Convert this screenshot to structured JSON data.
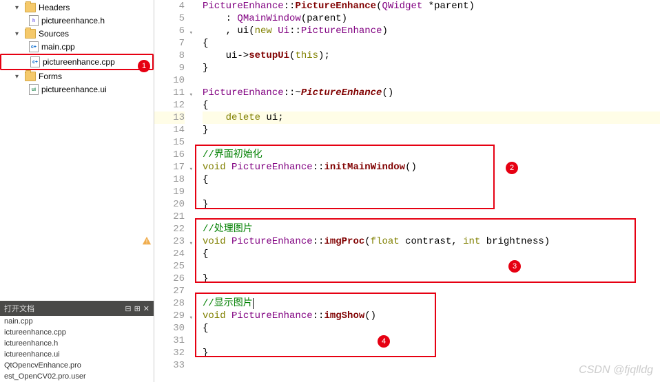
{
  "tree": {
    "headers": "Headers",
    "headers_file": "pictureenhance.h",
    "sources": "Sources",
    "main_cpp": "main.cpp",
    "pe_cpp": "pictureenhance.cpp",
    "forms": "Forms",
    "pe_ui": "pictureenhance.ui"
  },
  "openDocs": {
    "title": "打开文档",
    "items": [
      "nain.cpp",
      "ictureenhance.cpp",
      "ictureenhance.h",
      "ictureenhance.ui",
      "QtOpencvEnhance.pro",
      "est_OpenCV02.pro.user"
    ]
  },
  "code": {
    "l4": "PictureEnhance::PictureEnhance(QWidget *parent)",
    "l5": "    : QMainWindow(parent)",
    "l6": "    , ui(new Ui::PictureEnhance)",
    "l7": "{",
    "l8": "    ui->setupUi(this);",
    "l9": "}",
    "l10": "",
    "l11": "PictureEnhance::~PictureEnhance()",
    "l12": "{",
    "l13": "    delete ui;",
    "l14": "}",
    "l15": "",
    "l16": "//界面初始化",
    "l17": "void PictureEnhance::initMainWindow()",
    "l18": "{",
    "l19": "",
    "l20": "}",
    "l21": "",
    "l22": "//处理图片",
    "l23": "void PictureEnhance::imgProc(float contrast, int brightness)",
    "l24": "{",
    "l25": "",
    "l26": "}",
    "l27": "",
    "l28": "//显示图片",
    "l29": "void PictureEnhance::imgShow()",
    "l30": "{",
    "l31": "",
    "l32": "}",
    "l33": ""
  },
  "lineNumbers": [
    "4",
    "5",
    "6",
    "7",
    "8",
    "9",
    "10",
    "11",
    "12",
    "13",
    "14",
    "15",
    "16",
    "17",
    "18",
    "19",
    "20",
    "21",
    "22",
    "23",
    "24",
    "25",
    "26",
    "27",
    "28",
    "29",
    "30",
    "31",
    "32",
    "33"
  ],
  "badges": {
    "b1": "1",
    "b2": "2",
    "b3": "3",
    "b4": "4"
  },
  "watermark": "CSDN @fjqlldg"
}
